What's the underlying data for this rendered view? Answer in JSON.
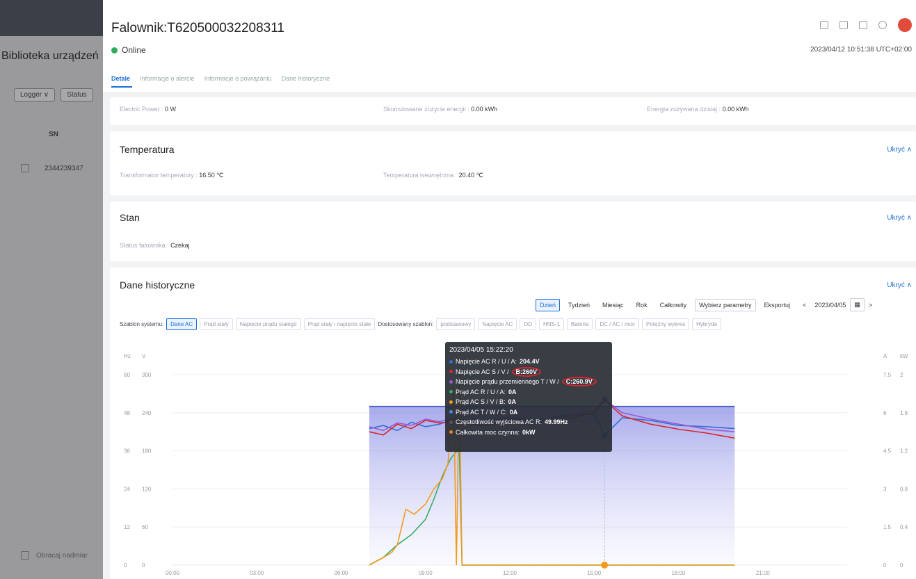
{
  "sidebar": {
    "title": "Biblioteka urządzeń",
    "filter_logger": "Logger ∨",
    "filter_status": "Status",
    "col_sn": "SN",
    "row_sn": "2344239347",
    "bottom_label": "Obracaj nadmiar"
  },
  "header": {
    "title": "Falownik:T620500032208311",
    "status": "Online",
    "datetime": "2023/04/12 10:51:38 UTC+02:00",
    "tabs": [
      "Detale",
      "Informacje o alercie",
      "Informacje o powiązaniu",
      "Dane historyczne"
    ]
  },
  "power": {
    "electric_label": "Electric Power :",
    "electric_value": "0 W",
    "accum_label": "Skumulowane zużycie energii :",
    "accum_value": "0.00 kWh",
    "today_label": "Energia zużywana dzisiaj :",
    "today_value": "0.00 kWh"
  },
  "temperature": {
    "title": "Temperatura",
    "hide": "Ukryć",
    "transformer_label": "Transformator temperatury :",
    "transformer_value": "16.50 ℃",
    "internal_label": "Temperatura wewnętrzna :",
    "internal_value": "20.40 ℃"
  },
  "state": {
    "title": "Stan",
    "hide": "Ukryć",
    "inverter_label": "Status falownika :",
    "inverter_value": "Czekaj"
  },
  "history": {
    "title": "Dane historyczne",
    "hide": "Ukryć",
    "periods": [
      "Dzień",
      "Tydzień",
      "Miesiąc",
      "Rok",
      "Całkowity"
    ],
    "active_period": "Dzień",
    "select_params": "Wybierz parametry",
    "export": "Eksportuj",
    "date": "2023/04/05",
    "template_label": "Szablon systemu:",
    "system_templates": [
      "Dane AC",
      "Prąd stały",
      "Napięcie prądu stałego",
      "Prąd stały i napięcie stałe"
    ],
    "custom_label": "Dostosowany szablon:",
    "custom_templates": [
      "podstawowy",
      "Napięcie AC",
      "DD",
      "HNS-1",
      "Bateria",
      "DC / AC / moc",
      "Potężny wykres",
      "Hybryda"
    ]
  },
  "tooltip": {
    "time": "2023/04/05 15:22:20",
    "rows": [
      {
        "label": "Napięcie AC R / U / A:",
        "value": "204.4V",
        "color": "#2f6fd6",
        "circled": false
      },
      {
        "label": "Napięcie AC S / V / ",
        "value": "B:260V",
        "color": "#d8262c",
        "circled": true
      },
      {
        "label": "Napięcie prądu przemiennego T / W / ",
        "value": "C:260.9V",
        "color": "#9b59d0",
        "circled": true
      },
      {
        "label": "Prąd AC R / U / A:",
        "value": "0A",
        "color": "#3aaa6a",
        "circled": false
      },
      {
        "label": "Prąd AC S / V / B:",
        "value": "0A",
        "color": "#f39a1c",
        "circled": false
      },
      {
        "label": "Prąd AC T / W / C:",
        "value": "0A",
        "color": "#3a8de0",
        "circled": false
      },
      {
        "label": "Częstotliwość wyjściowa AC R:",
        "value": "49.99Hz",
        "color": "#556",
        "circled": false
      },
      {
        "label": "Całkowita moc czynna:",
        "value": "0kW",
        "color": "#f0801c",
        "circled": false
      }
    ]
  },
  "chart_data": {
    "type": "line",
    "x_ticks": [
      "00:00",
      "03:00",
      "06:00",
      "09:00",
      "12:00",
      "15:00",
      "18:00",
      "21:00"
    ],
    "left_axis_hz": [
      "60",
      "48",
      "36",
      "24",
      "12",
      "0"
    ],
    "left_axis_v": [
      "300",
      "240",
      "180",
      "120",
      "60",
      "0"
    ],
    "right_axis_a": [
      "7.5",
      "6",
      "4.5",
      "3",
      "1.5",
      "0"
    ],
    "right_axis_kw": [
      "2",
      "1.6",
      "1.2",
      "0.8",
      "0.4",
      "0"
    ],
    "unit_labels": [
      "Hz",
      "V",
      "A",
      "kW"
    ],
    "colors": {
      "voltage_r": "#2f6fd6",
      "voltage_s": "#d8262c",
      "voltage_t": "#9b59d0",
      "current_r": "#3aaa6a",
      "current_s": "#f39a1c",
      "frequency": "#3758c8"
    },
    "series": [
      {
        "name": "Napięcie AC R / U / A",
        "axis": "V",
        "x": [
          7.0,
          7.5,
          8.0,
          8.5,
          9.0,
          9.5,
          10.0,
          11.0,
          12.0,
          13.0,
          14.0,
          15.0,
          15.37,
          16.0,
          17.0,
          18.0,
          19.0,
          20.0
        ],
        "y": [
          215,
          220,
          212,
          225,
          218,
          222,
          230,
          226,
          232,
          228,
          236,
          238,
          204.4,
          232,
          228,
          220,
          218,
          215
        ]
      },
      {
        "name": "Napięcie AC S / V",
        "axis": "V",
        "x": [
          7.0,
          7.5,
          8.0,
          8.5,
          9.0,
          9.5,
          10.0,
          11.0,
          12.0,
          13.0,
          14.0,
          15.0,
          15.37,
          16.0,
          17.0,
          18.0,
          19.0,
          20.0
        ],
        "y": [
          210,
          205,
          222,
          215,
          228,
          224,
          226,
          220,
          226,
          224,
          230,
          240,
          260,
          235,
          222,
          214,
          208,
          200
        ]
      },
      {
        "name": "Napięcie prądu przemiennego T / W",
        "axis": "V",
        "x": [
          7.0,
          7.5,
          8.0,
          8.5,
          9.0,
          9.5,
          10.0,
          11.0,
          12.0,
          13.0,
          14.0,
          15.0,
          15.37,
          16.0,
          17.0,
          18.0,
          19.0,
          20.0
        ],
        "y": [
          218,
          212,
          224,
          220,
          230,
          226,
          232,
          224,
          230,
          226,
          234,
          244,
          260.9,
          240,
          230,
          222,
          214,
          210
        ]
      },
      {
        "name": "Częstotliwość wyjściowa AC R",
        "axis": "Hz",
        "x": [
          7.0,
          20.0
        ],
        "y": [
          49.99,
          49.99
        ]
      },
      {
        "name": "Prąd AC R / U / A",
        "axis": "A",
        "x": [
          7.0,
          7.5,
          8.0,
          8.5,
          9.0,
          9.3,
          9.6,
          9.9,
          10.2,
          10.3,
          10.4,
          15.37,
          20.0
        ],
        "y": [
          0.0,
          0.3,
          0.8,
          1.2,
          1.8,
          2.6,
          3.5,
          4.2,
          4.6,
          0.0,
          0.0,
          0.0,
          0.0
        ]
      },
      {
        "name": "Prąd AC S / V / B",
        "axis": "A",
        "x": [
          7.0,
          7.5,
          7.8,
          8.0,
          8.3,
          8.6,
          9.0,
          9.3,
          9.6,
          9.8,
          10.0,
          10.1,
          10.2,
          10.3,
          10.4,
          15.37,
          20.0
        ],
        "y": [
          0.0,
          0.3,
          0.5,
          0.8,
          2.2,
          2.0,
          2.4,
          3.0,
          3.4,
          4.0,
          7.1,
          0.0,
          7.1,
          0.0,
          0.0,
          0.0,
          0.0
        ]
      }
    ]
  }
}
